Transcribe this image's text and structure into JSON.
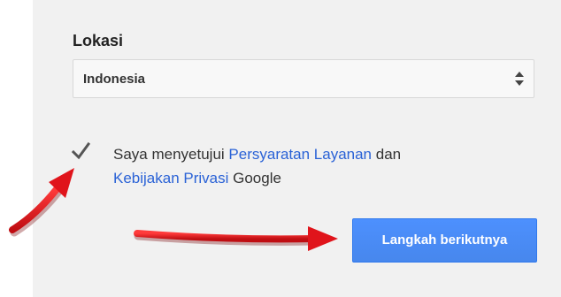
{
  "location": {
    "label": "Lokasi",
    "selected_value": "Indonesia",
    "arrows_icon": "up-down-arrows-icon"
  },
  "agreement": {
    "checked": true,
    "check_icon": "checkmark-icon",
    "text_before": "Saya menyetujui ",
    "terms_link": "Persyaratan Layanan",
    "text_middle": " dan ",
    "privacy_link": "Kebijakan Privasi",
    "text_after": " Google"
  },
  "actions": {
    "next_label": "Langkah berikutnya"
  },
  "colors": {
    "panel_bg": "#f1f1f1",
    "link": "#2a62d6",
    "button_bg": "#4d90fe",
    "annotation_arrow": "#e0141b"
  },
  "annotations": {
    "arrow_icon": "red-arrow-icon"
  }
}
